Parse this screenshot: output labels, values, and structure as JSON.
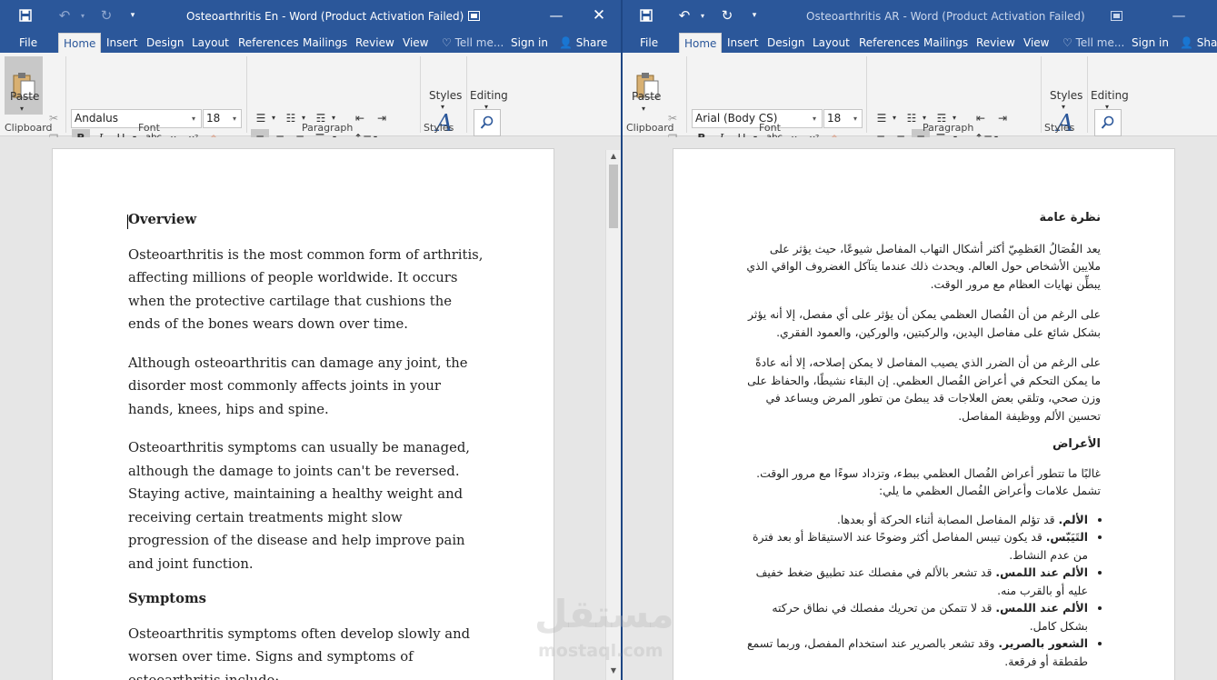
{
  "left_window": {
    "title": "Osteoarthritis En - Word (Product Activation Failed)",
    "tabs": [
      "File",
      "Home",
      "Insert",
      "Design",
      "Layout",
      "References",
      "Mailings",
      "Review",
      "View",
      "Tell me...",
      "Sign in",
      "Share"
    ],
    "font_name": "Andalus",
    "font_size": "18",
    "groups": {
      "clipboard": "Clipboard",
      "font": "Font",
      "paragraph": "Paragraph",
      "styles": "Styles"
    },
    "paste_label": "Paste",
    "styles_label": "Styles",
    "editing_label": "Editing",
    "doc": {
      "h1": "Overview",
      "p1": "Osteoarthritis is the most common form of arthritis, affecting millions of people worldwide. It occurs when the protective cartilage that cushions the ends of the bones wears down over time.",
      "p2": "Although osteoarthritis can damage any joint, the disorder most commonly affects joints in your hands, knees, hips and spine.",
      "p3": "Osteoarthritis symptoms can usually be managed, although the damage to joints can't be reversed. Staying active, maintaining a healthy weight and receiving certain treatments might slow progression of the disease and help improve pain and joint function.",
      "h2": "Symptoms",
      "p4": "Osteoarthritis symptoms often develop slowly and worsen over time. Signs and symptoms of osteoarthritis include:"
    }
  },
  "right_window": {
    "title": "Osteoarthritis AR - Word (Product Activation Failed)",
    "tabs": [
      "File",
      "Home",
      "Insert",
      "Design",
      "Layout",
      "References",
      "Mailings",
      "Review",
      "View",
      "Tell me...",
      "Sign in",
      "Shar"
    ],
    "font_name": "Arial (Body CS)",
    "font_size": "18",
    "groups": {
      "clipboard": "Clipboard",
      "font": "Font",
      "paragraph": "Paragraph",
      "styles": "Styles"
    },
    "paste_label": "Paste",
    "styles_label": "Styles",
    "editing_label": "Editing",
    "doc": {
      "h1": "نظرة عامة",
      "p1": "يعد الفُصَالُ العَظمِيّ أكثر أشكال التهاب المفاصل شيوعًا، حيث يؤثر على ملايين الأشخاص حول العالم. ويحدث ذلك عندما يتآكل الغضروف الواقي الذي يبطِّن نهايات العظام مع مرور الوقت.",
      "p2": "على الرغم من أن الفُصال العظمي يمكن أن يؤثر على أي مفصل، إلا أنه يؤثر بشكل شائع على مفاصل اليدين، والركبتين، والوركين، والعمود الفقري.",
      "p3": "على الرغم من أن الضرر الذي يصيب المفاصل لا يمكن إصلاحه، إلا أنه عادةً ما يمكن التحكم في أعراض الفُصال العظمي. إن البقاء نشيطًا، والحفاظ على وزن صحي، وتلقي بعض العلاجات قد يبطئ من تطور المرض ويساعد في تحسين الألم ووظيفة المفاصل.",
      "h2": "الأعراض",
      "p4": "غالبًا ما تتطور أعراض الفُصال العظمي ببطء، وتزداد سوءًا مع مرور الوقت. تشمل علامات وأعراض الفُصال العظمي ما يلي:",
      "list": [
        {
          "b": "الألم.",
          "t": " قد تؤلم المفاصل المصابة أثناء الحركة أو بعدها."
        },
        {
          "b": "التَيَبّس.",
          "t": " قد يكون تيبس المفاصل أكثر وضوحًا عند الاستيقاظ أو بعد فترة من عدم النشاط."
        },
        {
          "b": "الألم عند اللمس.",
          "t": " قد تشعر بالألم في مفصلك عند تطبيق ضغط خفيف عليه أو بالقرب منه."
        },
        {
          "b": "الألم عند اللمس.",
          "t": " قد لا تتمكن من تحريك مفصلك في نطاق حركته بشكل كامل."
        },
        {
          "b": "الشعور بالصرير.",
          "t": " وقد تشعر بالصرير عند استخدام المفصل، وربما تسمع طقطقة أو فرقعة."
        }
      ]
    }
  },
  "watermark": {
    "ar": "مستقل",
    "en": "mostaql.com"
  },
  "icons": [
    "save-icon",
    "undo-icon",
    "redo-icon",
    "restore-icon",
    "minimize-icon",
    "close-icon",
    "lightbulb-icon",
    "person-icon",
    "paste-icon",
    "cut-icon",
    "copy-icon",
    "format-painter-icon",
    "bold-icon",
    "italic-icon",
    "underline-icon",
    "strikethrough-icon",
    "subscript-icon",
    "superscript-icon",
    "clear-format-icon",
    "text-effects-icon",
    "highlight-icon",
    "font-color-icon",
    "change-case-icon",
    "grow-font-icon",
    "shrink-font-icon",
    "bullets-icon",
    "numbering-icon",
    "multilevel-icon",
    "decrease-indent-icon",
    "increase-indent-icon",
    "align-left-icon",
    "center-icon",
    "align-right-icon",
    "justify-icon",
    "line-spacing-icon",
    "ltr-icon",
    "rtl-icon",
    "shading-icon",
    "borders-icon",
    "sort-icon",
    "pilcrow-icon",
    "styles-icon",
    "search-icon"
  ]
}
